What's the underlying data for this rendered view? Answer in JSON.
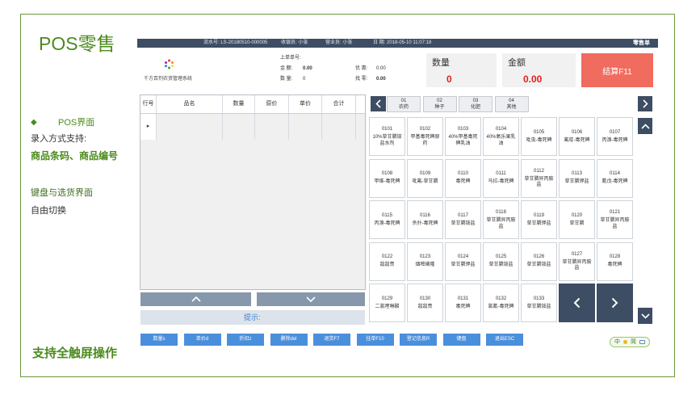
{
  "colors": {
    "accent_green": "#4b8b1d",
    "pos_dark": "#3d4d63",
    "checkout": "#f06c5f",
    "action_blue": "#4a8fdc",
    "value_red": "#e31e24",
    "hint_blue": "#3a7fd5"
  },
  "slide": {
    "title": "POS零售",
    "bullet_marker": "◆",
    "bullet_title": "POS界面",
    "input_methods_label": "录入方式支持:",
    "input_methods": "商品条码、商品编号",
    "switch_line1": "键盘与选货界面",
    "switch_line2": "自由切换",
    "touch_note": "支持全触屏操作"
  },
  "pos": {
    "topbar": {
      "serial_label": "流水号:",
      "serial": "LS-20180510-000005",
      "cashier_label": "收银员:",
      "cashier": "小张",
      "salesperson_label": "营业员:",
      "salesperson": "小张",
      "date_label": "日 期:",
      "date": "2018-05-10 11:07:18",
      "doc_type": "零售单"
    },
    "brand": {
      "system_name": "千方百剂农资管理系统",
      "logo_icon": "colorful-dots-logo"
    },
    "summary": {
      "last_order_label": "上单单号:",
      "amount_label": "金 额:",
      "amount": "0.00",
      "discount_label": "优 惠:",
      "discount": "0.00",
      "quantity_label": "数 量:",
      "quantity": "0",
      "change_label": "找 零:",
      "change": "0.00"
    },
    "stats": {
      "quantity_label": "数量",
      "quantity": "0",
      "amount_label": "金额",
      "amount": "0.00",
      "checkout_label": "结算F11"
    },
    "cart": {
      "columns": [
        "行号",
        "品名",
        "数量",
        "原价",
        "单价",
        "合计"
      ],
      "rows": [
        {
          "indicator": "▸"
        }
      ]
    },
    "hint_label": "提示:",
    "categories": [
      {
        "code": "01",
        "name": "农药"
      },
      {
        "code": "02",
        "name": "种子"
      },
      {
        "code": "03",
        "name": "化肥"
      },
      {
        "code": "04",
        "name": "其他"
      }
    ],
    "products": [
      {
        "code": "0101",
        "name": "10%草甘膦铵盐水剂"
      },
      {
        "code": "0102",
        "name": "甲基毒死蜱原药"
      },
      {
        "code": "0103",
        "name": "40%甲基毒死蜱乳油"
      },
      {
        "code": "0104",
        "name": "40%氧乐果乳油"
      },
      {
        "code": "0105",
        "name": "吡虫-毒死蜱"
      },
      {
        "code": "0106",
        "name": "氟啶-毒死蜱"
      },
      {
        "code": "0107",
        "name": "丙溴-毒死蜱"
      },
      {
        "code": "0108",
        "name": "甲维-毒死蜱"
      },
      {
        "code": "0109",
        "name": "吡氟-草甘膦"
      },
      {
        "code": "0110",
        "name": "毒死蜱"
      },
      {
        "code": "0111",
        "name": "马拉-毒死蜱"
      },
      {
        "code": "0112",
        "name": "草甘膦异丙胺盐"
      },
      {
        "code": "0113",
        "name": "草甘膦钾盐"
      },
      {
        "code": "0114",
        "name": "氰戊-毒死蜱"
      },
      {
        "code": "0115",
        "name": "丙溴-毒死蜱"
      },
      {
        "code": "0116",
        "name": "杀扑-毒死蜱"
      },
      {
        "code": "0117",
        "name": "草甘膦铵盐"
      },
      {
        "code": "0118",
        "name": "草甘膦异丙胺盐"
      },
      {
        "code": "0119",
        "name": "草甘膦钾盐"
      },
      {
        "code": "0120",
        "name": "草甘膦"
      },
      {
        "code": "0121",
        "name": "草甘膦异丙胺盐"
      },
      {
        "code": "0122",
        "name": "敌敌畏"
      },
      {
        "code": "0123",
        "name": "烟嘧磺隆"
      },
      {
        "code": "0124",
        "name": "草甘膦钾盐"
      },
      {
        "code": "0125",
        "name": "草甘膦铵盐"
      },
      {
        "code": "0126",
        "name": "草甘膦铵盐"
      },
      {
        "code": "0127",
        "name": "草甘膦异丙胺盐"
      },
      {
        "code": "0128",
        "name": "毒死蜱"
      },
      {
        "code": "0129",
        "name": "二氯喹啉酸"
      },
      {
        "code": "0130",
        "name": "敌敌畏"
      },
      {
        "code": "0131",
        "name": "毒死蜱"
      },
      {
        "code": "0132",
        "name": "氯氰-毒死蜱"
      },
      {
        "code": "0133",
        "name": "草甘膦铵盐"
      }
    ],
    "actions": [
      "数量s",
      "单价d",
      "折扣z",
      "删除del",
      "退货F7",
      "挂单F10",
      "登记信息R",
      "键盘",
      "退出ESC"
    ]
  },
  "ime": {
    "mode": "中",
    "script": "简"
  }
}
